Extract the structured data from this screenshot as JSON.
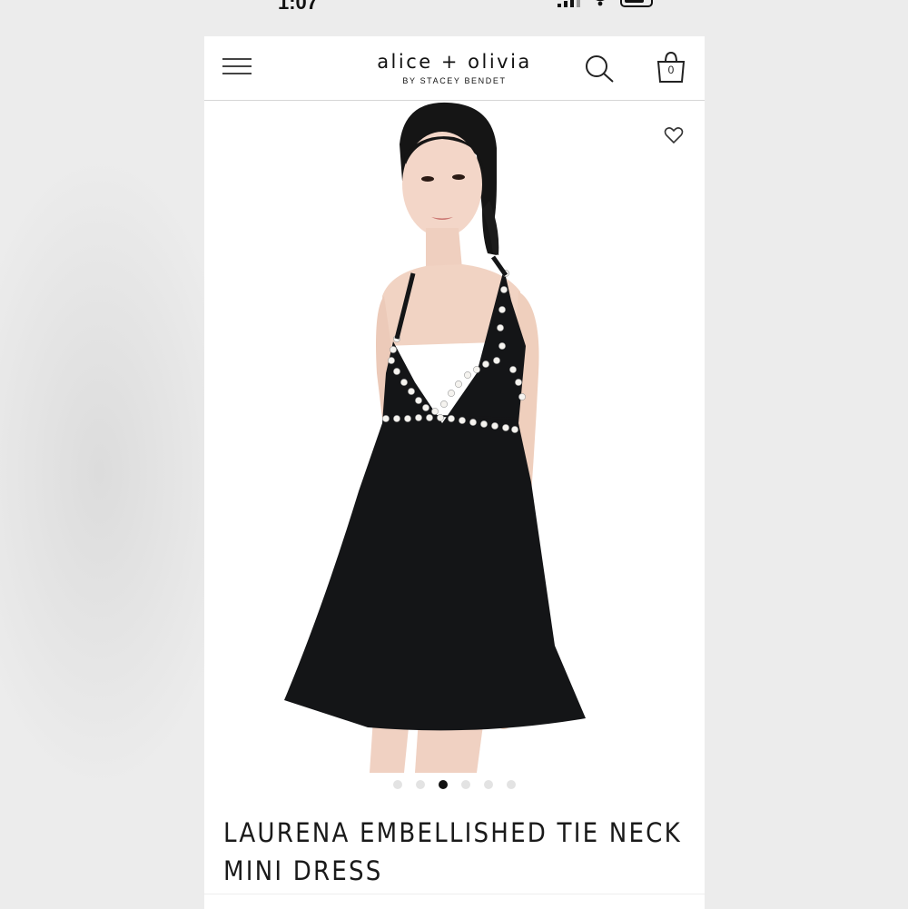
{
  "status_bar": {
    "time": "1:07"
  },
  "header": {
    "brand_name": "alice + olivia",
    "brand_sub": "BY STACEY BENDET",
    "cart_count": "0",
    "icons": [
      "menu-icon",
      "search-icon",
      "shopping-bag-icon"
    ]
  },
  "product": {
    "title_line1": "LAURENA EMBELLISHED TIE NECK",
    "title_line2": "MINI DRESS",
    "image_description": "model-in-black-halter-mini-dress-with-pearl-trim"
  },
  "carousel": {
    "total": 6,
    "active_index": 2
  },
  "colors": {
    "accent": "#111111",
    "dress": "#141517",
    "dot_inactive": "#e3e3e3"
  }
}
